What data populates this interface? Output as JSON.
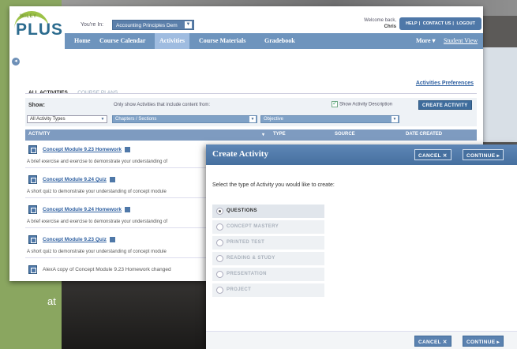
{
  "background": {
    "stray_text": "at"
  },
  "app": {
    "logo": {
      "brand": "WILEY",
      "product": "PLUS"
    },
    "course": {
      "label": "You're In:",
      "selected": "Accounting Principles Dem"
    },
    "welcome": {
      "prefix": "Welcome back,",
      "user": "Chris"
    },
    "top_links": [
      "HELP",
      "CONTACT US",
      "LOGOUT"
    ],
    "nav": {
      "items": [
        "Home",
        "Course Calendar",
        "Activities",
        "Course Materials",
        "Gradebook"
      ],
      "active": "Activities",
      "more": "More ▾",
      "student_view": "Student View"
    },
    "tabs": [
      "ALL ACTIVITIES",
      "COURSE PLANS"
    ],
    "activities_preferences": "Activities Preferences",
    "filters": {
      "show_label": "Show:",
      "only_show": "Only show Activities that include content from:",
      "show_description": "Show Activity Description",
      "create_button": "CREATE ACTIVITY",
      "type_value": "All Activity Types",
      "chapters_value": "Chapters / Sections",
      "objective_value": "Objective"
    },
    "table": {
      "columns": [
        "ACTIVITY",
        "TYPE",
        "SOURCE",
        "DATE CREATED"
      ],
      "rows": [
        {
          "title": "Concept Module 9.23 Homework",
          "desc": "A brief exercise and exercise to demonstrate your understanding of"
        },
        {
          "title": "Concept Module 9.24 Quiz",
          "desc": "A short quiz to demonstrate your understanding of concept module"
        },
        {
          "title": "Concept Module 9.24 Homework",
          "desc": "A brief exercise and exercise to demonstrate your understanding of"
        },
        {
          "title": "Concept Module 9.23 Quiz",
          "desc": "A short quiz to demonstrate your understanding of concept module"
        },
        {
          "title": "AlexA copy of Concept Module 9.23 Homework  changed",
          "desc": ""
        }
      ]
    }
  },
  "dialog": {
    "title": "Create Activity",
    "cancel": "CANCEL ✕",
    "continue": "CONTINUE ▸",
    "prompt": "Select the type of Activity you would like to create:",
    "options": [
      "QUESTIONS",
      "CONCEPT MASTERY",
      "PRINTED TEST",
      "READING & STUDY",
      "PRESENTATION",
      "PROJECT"
    ],
    "selected_option": "QUESTIONS"
  },
  "colors": {
    "nav_blue": "#6e94bd",
    "header_blue": "#4f78a8",
    "link_blue": "#2d5fa0",
    "logo_green": "#9cc247",
    "page_green": "#8aa660"
  }
}
